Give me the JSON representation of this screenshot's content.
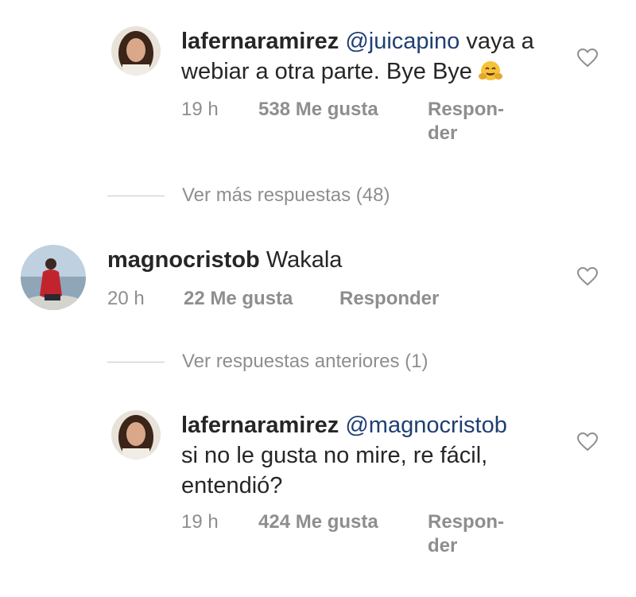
{
  "comments": [
    {
      "username": "lafernaramirez",
      "mention": "@juicapino",
      "line1_rest": "vaya a",
      "line2": "webiar a otra parte. Bye Bye",
      "emoji": "hugging-face-emoji",
      "time": "19 h",
      "likes": "538 Me gusta",
      "reply_line1": "Respon-",
      "reply_line2": "der"
    },
    {
      "username": "magnocristob",
      "text": "Wakala",
      "time": "20 h",
      "likes": "22 Me gusta",
      "reply": "Responder"
    },
    {
      "username": "lafernaramirez",
      "mention": "@magnocristob",
      "line2": "si no le gusta no mire, re fácil,",
      "line3": "entendió?",
      "time": "19 h",
      "likes": "424 Me gusta",
      "reply_line1": "Respon-",
      "reply_line2": "der"
    }
  ],
  "view_more_replies": "Ver más respuestas (48)",
  "view_previous_replies": "Ver respuestas anteriores (1)",
  "icons": {
    "like": "heart-outline-icon"
  },
  "colors": {
    "text": "#262626",
    "secondary": "#8e8e8e",
    "mention": "#1f3f73"
  }
}
